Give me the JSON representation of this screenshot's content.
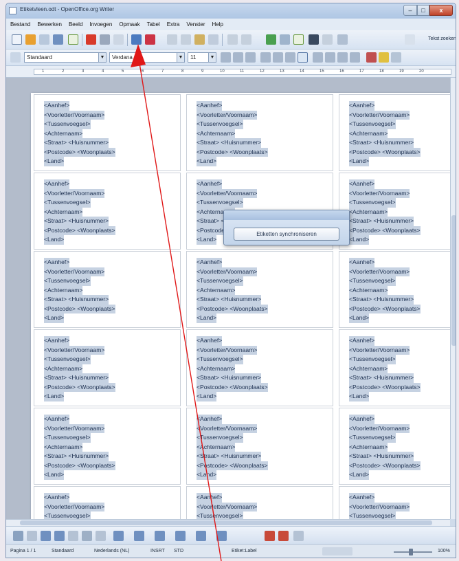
{
  "window": {
    "title": "Etiketvleen.odt - OpenOffice.org Writer",
    "min_glyph": "–",
    "max_glyph": "□",
    "close_glyph": "x"
  },
  "menu": [
    "Bestand",
    "Bewerken",
    "Beeld",
    "Invoegen",
    "Opmaak",
    "Tabel",
    "Extra",
    "Venster",
    "Help"
  ],
  "toolbar": {
    "style_value": "Standaard",
    "font_value": "Verdana",
    "size_value": "11",
    "dropdown_glyph": "▼",
    "right_link": "Tekst zoeken"
  },
  "ruler": {
    "labels": [
      "1",
      "2",
      "3",
      "4",
      "5",
      "6",
      "7",
      "8",
      "9",
      "10",
      "11",
      "12",
      "13",
      "14",
      "15",
      "16",
      "17",
      "18",
      "19",
      "20"
    ]
  },
  "label_fields": [
    "<Aanhef>",
    "<Voorletter/Voornaam>",
    "<Tussenvoegsel>",
    "<Achternaam>",
    "<Straat> <Huisnummer>",
    "<Postcode> <Woonplaats>",
    "<Land>"
  ],
  "dialog": {
    "button_label": "Etiketten synchroniseren"
  },
  "status": {
    "page": "Pagina 1 / 1",
    "style": "Standaard",
    "language": "Nederlands (NL)",
    "insert": "INSRT",
    "selection": "STD",
    "extra": "Etiket:Label",
    "zoom": "100%"
  },
  "colors": {
    "accent": "#3a6fb0",
    "arrow": "#e01818",
    "field_highlight": "#c6d2e2"
  }
}
